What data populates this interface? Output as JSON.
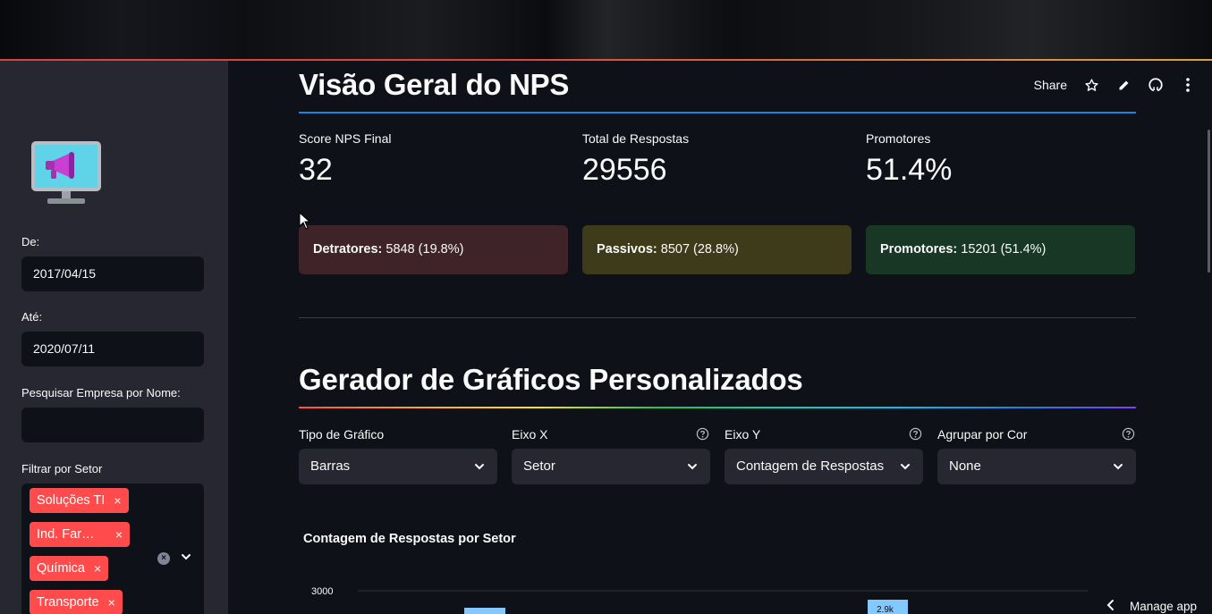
{
  "sidebar": {
    "from_label": "De:",
    "from_value": "2017/04/15",
    "to_label": "Até:",
    "to_value": "2020/07/11",
    "search_label": "Pesquisar Empresa por Nome:",
    "search_value": "",
    "sector_label": "Filtrar por Setor",
    "sector_tags": [
      "Soluções TI",
      "Ind. Far…",
      "Química",
      "Transporte"
    ]
  },
  "header": {
    "title": "Visão Geral do NPS",
    "share_label": "Share"
  },
  "metrics": [
    {
      "label": "Score NPS Final",
      "value": "32"
    },
    {
      "label": "Total de Respostas",
      "value": "29556"
    },
    {
      "label": "Promotores",
      "value": "51.4%"
    }
  ],
  "cards": {
    "detractors_label": "Detratores:",
    "detractors_value": "5848 (19.8%)",
    "passives_label": "Passivos:",
    "passives_value": "8507 (28.8%)",
    "promoters_label": "Promotores:",
    "promoters_value": "15201 (51.4%)"
  },
  "generator": {
    "title": "Gerador de Gráficos Personalizados",
    "chart_type_label": "Tipo de Gráfico",
    "chart_type_value": "Barras",
    "x_axis_label": "Eixo X",
    "x_axis_value": "Setor",
    "y_axis_label": "Eixo Y",
    "y_axis_value": "Contagem de Respostas",
    "color_label": "Agrupar por Cor",
    "color_value": "None"
  },
  "chart": {
    "title": "Contagem de Respostas por Setor",
    "y_tick": "3000",
    "bar_label": "2.9k"
  },
  "footer": {
    "manage_label": "Manage app"
  },
  "colors": {
    "accent": "#ff4b4b",
    "primary_rule": "#1c83e1",
    "bar": "#83c9ff"
  }
}
